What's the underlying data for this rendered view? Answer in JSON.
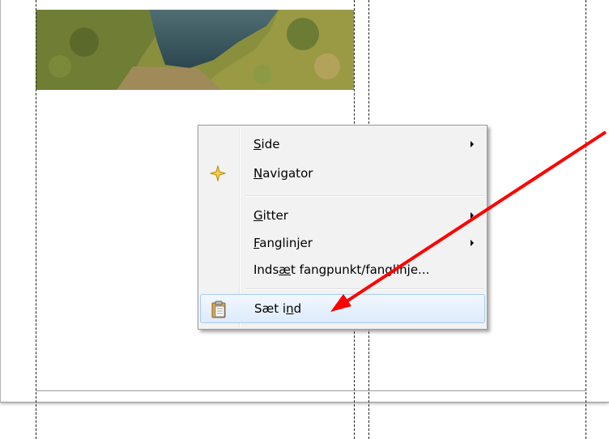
{
  "context_menu": {
    "items": [
      {
        "pre": "",
        "accel": "S",
        "post": "ide",
        "submenu": true,
        "icon": "none"
      },
      {
        "pre": "",
        "accel": "N",
        "post": "avigator",
        "submenu": false,
        "icon": "navigator-star-icon"
      },
      {
        "pre": "",
        "accel": "G",
        "post": "itter",
        "submenu": true,
        "icon": "none"
      },
      {
        "pre": "",
        "accel": "F",
        "post": "anglinjer",
        "submenu": true,
        "icon": "none"
      },
      {
        "pre": "Inds",
        "accel": "æ",
        "post": "t fangpunkt/fanglinje...",
        "submenu": false,
        "icon": "none"
      },
      {
        "pre": "Sæt i",
        "accel": "n",
        "post": "d",
        "submenu": false,
        "icon": "clipboard-paste-icon",
        "highlighted": true
      }
    ]
  },
  "colors": {
    "annotation_arrow": "#ff0000",
    "highlight_border": "#a8cbf2",
    "menu_background": "#f2f2f2"
  }
}
